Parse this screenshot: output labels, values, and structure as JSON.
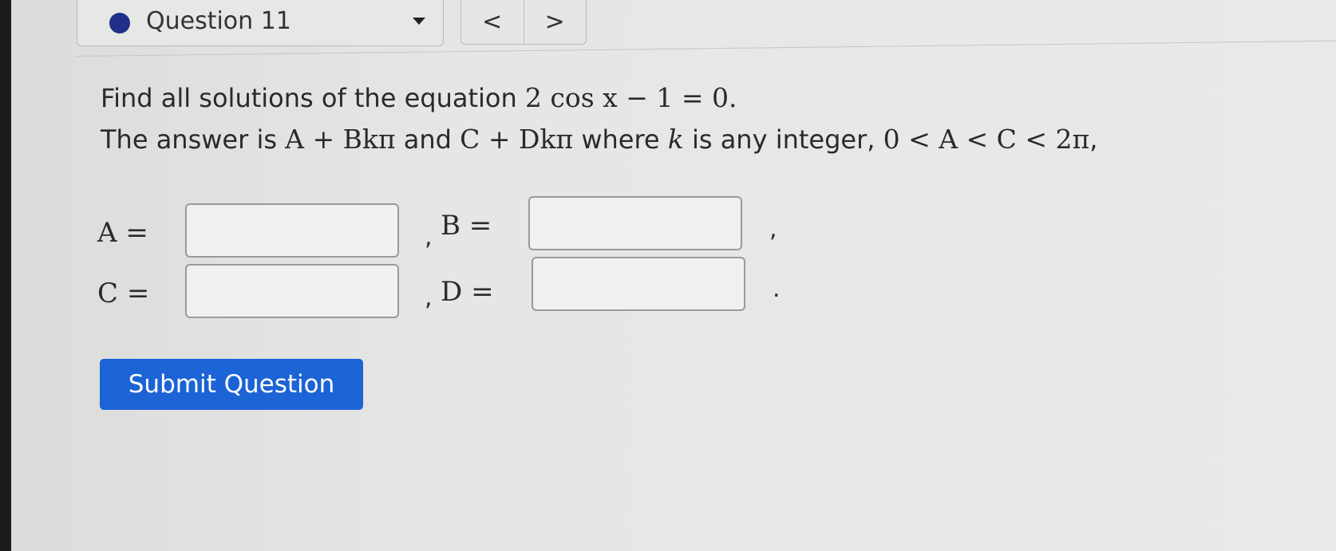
{
  "header": {
    "question_label": "Question 11",
    "prev_symbol": "<",
    "next_symbol": ">"
  },
  "prompt": {
    "line1_text": "Find all solutions of the equation ",
    "line1_math": "2 cos x − 1 = 0.",
    "line2_text_a": "The answer is ",
    "line2_math_a": "A + Bkπ",
    "line2_text_b": " and ",
    "line2_math_b": "C + Dkπ",
    "line2_text_c": " where ",
    "line2_math_c": "k",
    "line2_text_d": " is any integer, ",
    "line2_math_d": "0 < A < C < 2π",
    "line2_text_e": ","
  },
  "answers": {
    "a_label": "A =",
    "b_label": "B =",
    "c_label": "C =",
    "d_label": "D =",
    "comma": ",",
    "period": ".",
    "a_value": "",
    "b_value": "",
    "c_value": "",
    "d_value": ""
  },
  "submit": {
    "label": "Submit Question"
  },
  "colors": {
    "submit_background": "#1c63d6",
    "status_dot": "#1f2f8a"
  },
  "icons": {
    "status": "filled-circle-icon",
    "dropdown": "caret-down-icon",
    "previous": "chevron-left-icon",
    "next": "chevron-right-icon"
  }
}
